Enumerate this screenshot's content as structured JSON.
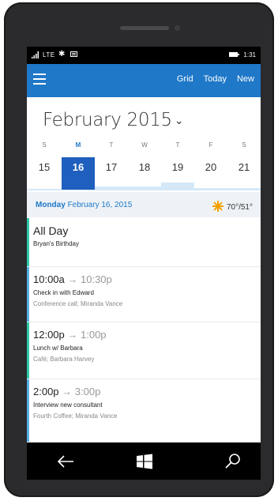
{
  "status_bar": {
    "network": "LTE",
    "time": "1:31"
  },
  "app_bar": {
    "actions": [
      "Grid",
      "Today",
      "New"
    ]
  },
  "calendar": {
    "month_label": "February 2015",
    "weekdays": [
      "S",
      "M",
      "T",
      "W",
      "T",
      "F",
      "S"
    ],
    "days": [
      "15",
      "16",
      "17",
      "18",
      "19",
      "20",
      "21"
    ],
    "selected_index": 1,
    "busy_levels": [
      0.1,
      0,
      0.25,
      0.25,
      0.5,
      0.15,
      0.15
    ]
  },
  "day_header": {
    "weekday": "Monday",
    "date": "February 16, 2015",
    "weather": "70°/51°"
  },
  "events": [
    {
      "title": "All Day",
      "line2": "Bryan's Birthday",
      "line3": "",
      "stripe_color": "#2ec9a8"
    },
    {
      "start": "10:00a",
      "end": "10:30p",
      "line2": "Check in with Edward",
      "line3": "Conference call; Miranda Vance",
      "stripe_color": "#56b0e6"
    },
    {
      "start": "12:00p",
      "end": "1:00p",
      "line2": "Lunch w/ Barbara",
      "line3": "Café; Barbara Harvey",
      "stripe_color": "#2ec9a8"
    },
    {
      "start": "2:00p",
      "end": "3:00p",
      "line2": "Interview new consultant",
      "line3": "Fourth Coffee; Miranda Vance",
      "stripe_color": "#56b0e6"
    }
  ],
  "colors": {
    "accent": "#1f78c8",
    "selected_day": "#1f5fbd"
  },
  "nav_bar": {
    "icons": [
      "back-icon",
      "windows-start-icon",
      "search-icon"
    ]
  }
}
